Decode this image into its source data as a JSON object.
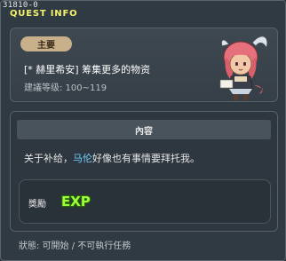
{
  "window": {
    "id_label": "31810-0",
    "title": "QUEST INFO"
  },
  "header": {
    "badge": "主要",
    "quest_name": "[* 赫里希安] 筹集更多的物资",
    "level_label": "建議等级: 100~119"
  },
  "content": {
    "section_title": "內容",
    "text_before": "关于补给，",
    "npc_name": "马伦",
    "text_after": "好像也有事情要拜托我。"
  },
  "reward": {
    "label": "獎勵",
    "icon": "exp-icon",
    "icon_text": "EXP"
  },
  "status": {
    "text": "狀態: 可開始 / 不可執行任務"
  },
  "colors": {
    "title": "#f4f26a",
    "badge": "#c7b08a",
    "npc_link": "#6fd1ff",
    "exp": "#9aff38"
  }
}
